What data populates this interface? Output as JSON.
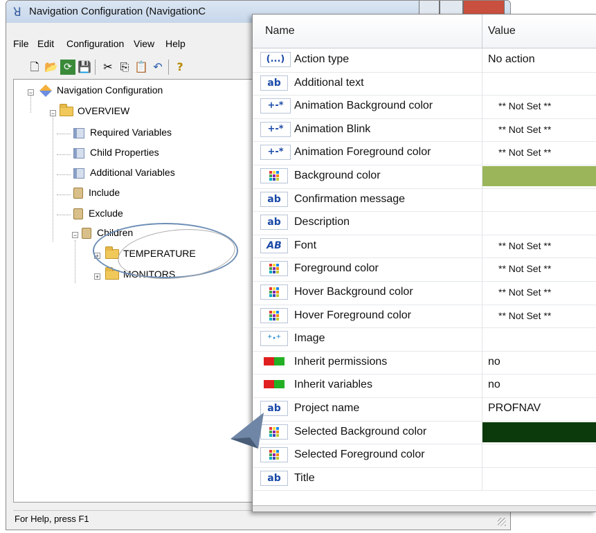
{
  "window": {
    "title": "Navigation Configuration (NavigationC"
  },
  "menu": [
    "File",
    "Edit",
    "Configuration",
    "View",
    "Help"
  ],
  "toolbar": [
    {
      "icon": "new-icon",
      "glyph": "🗋"
    },
    {
      "icon": "open-icon",
      "glyph": "📂"
    },
    {
      "icon": "refresh-icon",
      "glyph": "⟳"
    },
    {
      "icon": "save-icon",
      "glyph": "💾"
    },
    {
      "icon": "cut-icon",
      "glyph": "✂"
    },
    {
      "icon": "copy-icon",
      "glyph": "⎘"
    },
    {
      "icon": "paste-icon",
      "glyph": "📋"
    },
    {
      "icon": "undo-icon",
      "glyph": "↶"
    },
    {
      "icon": "help-icon",
      "glyph": "?"
    }
  ],
  "tree": {
    "root": "Navigation Configuration",
    "overview": "OVERVIEW",
    "required_variables": "Required Variables",
    "child_properties": "Child Properties",
    "additional_variables": "Additional Variables",
    "include": "Include",
    "exclude": "Exclude",
    "children": "Children",
    "temperature": "TEMPERATURE",
    "monitors": "MONITORS"
  },
  "status": {
    "text": "For Help, press F1"
  },
  "grid": {
    "col_name": "Name",
    "col_value": "Value",
    "rows": [
      {
        "icon": "ellipsis",
        "name": "Action type",
        "value": "No action"
      },
      {
        "icon": "ab",
        "name": "Additional text",
        "value": ""
      },
      {
        "icon": "plusminus",
        "name": "Animation Background color",
        "value": "** Not Set **"
      },
      {
        "icon": "plusminus",
        "name": "Animation Blink",
        "value": "** Not Set **"
      },
      {
        "icon": "plusminus",
        "name": "Animation Foreground color",
        "value": "** Not Set **"
      },
      {
        "icon": "palette",
        "name": "Background color",
        "value": "",
        "color": "#9ab55a"
      },
      {
        "icon": "ab",
        "name": "Confirmation message",
        "value": ""
      },
      {
        "icon": "ab",
        "name": "Description",
        "value": ""
      },
      {
        "icon": "font",
        "name": "Font",
        "value": "** Not Set **"
      },
      {
        "icon": "palette",
        "name": "Foreground color",
        "value": "** Not Set **"
      },
      {
        "icon": "palette",
        "name": "Hover Background color",
        "value": "** Not Set **"
      },
      {
        "icon": "palette",
        "name": "Hover Foreground color",
        "value": "** Not Set **"
      },
      {
        "icon": "image",
        "name": "Image",
        "value": ""
      },
      {
        "icon": "toggle",
        "name": "Inherit permissions",
        "value": "no"
      },
      {
        "icon": "toggle",
        "name": "Inherit variables",
        "value": "no"
      },
      {
        "icon": "ab",
        "name": "Project name",
        "value": "PROFNAV"
      },
      {
        "icon": "palette",
        "name": "Selected Background color",
        "value": "",
        "color": "#0c3a0c"
      },
      {
        "icon": "palette",
        "name": "Selected Foreground color",
        "value": ""
      },
      {
        "icon": "ab",
        "name": "Title",
        "value": ""
      }
    ]
  }
}
